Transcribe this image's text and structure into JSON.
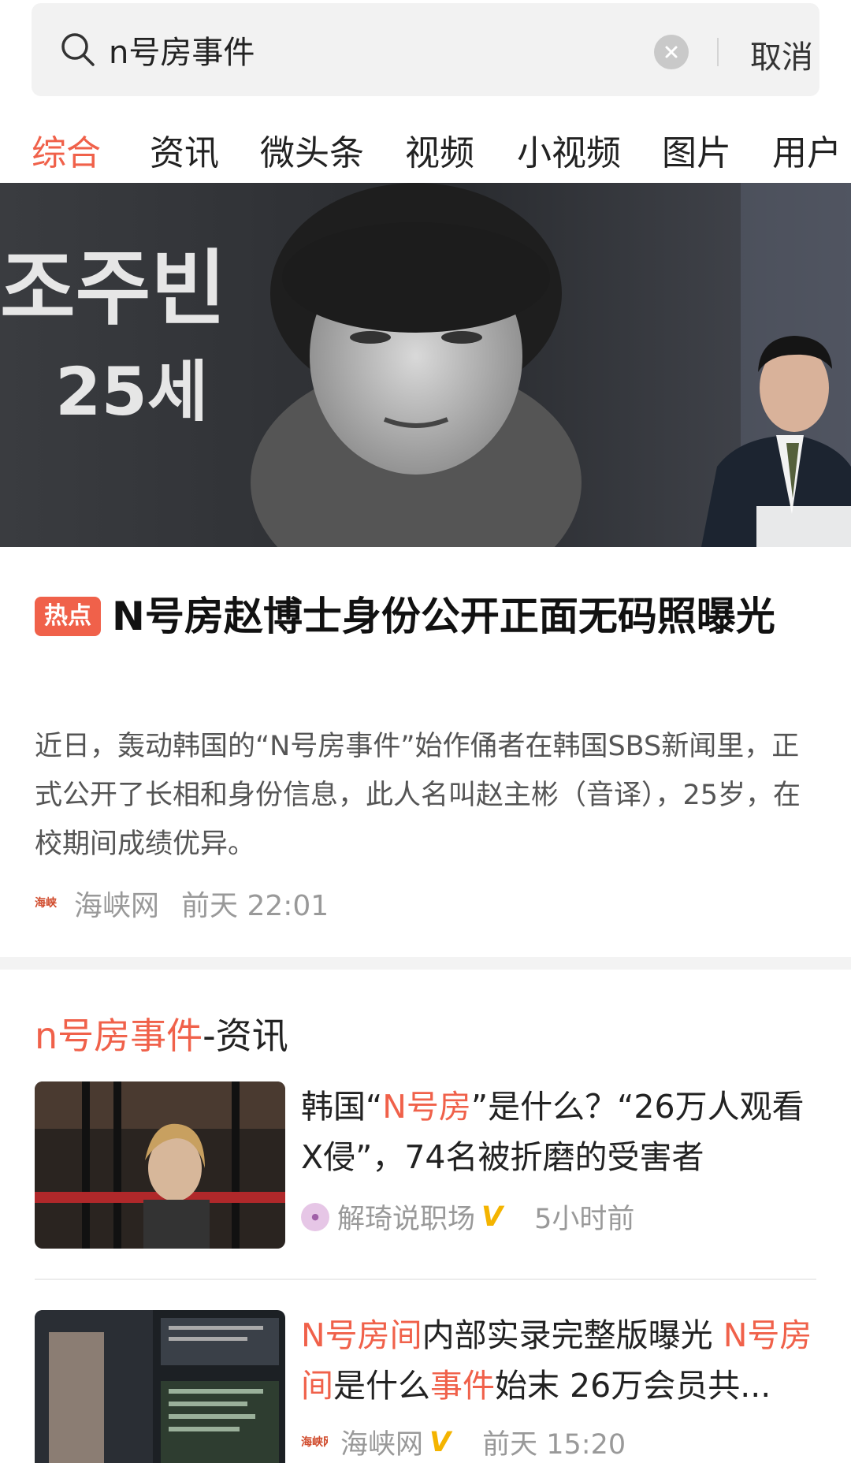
{
  "search": {
    "query": "n号房事件",
    "cancel_label": "取消"
  },
  "tabs": [
    {
      "label": "综合",
      "active": true
    },
    {
      "label": "资讯"
    },
    {
      "label": "微头条"
    },
    {
      "label": "视频"
    },
    {
      "label": "小视频"
    },
    {
      "label": "图片"
    },
    {
      "label": "用户"
    }
  ],
  "hero": {
    "overlay_name": "조주빈",
    "overlay_age": "25세"
  },
  "featured": {
    "badge": "热点",
    "title": "N号房赵博士身份公开正面无码照曝光",
    "summary": "近日，轰动韩国的“N号房事件”始作俑者在韩国SBS新闻里，正式公开了长相和身份信息，此人名叫赵主彬（音译），25岁，在校期间成绩优异。",
    "source": "海峡网",
    "time": "前天 22:01"
  },
  "section": {
    "highlight": "n号房事件",
    "suffix": "-资讯"
  },
  "news": [
    {
      "title_parts": [
        "韩国“",
        "N号房",
        "”是什么？“26万人观看X侵”，74名被折磨的受害者"
      ],
      "source": "解琦说职场",
      "verified": "V",
      "time": "5小时前"
    },
    {
      "title_parts": [
        "N号房间",
        "内部实录完整版曝光 ",
        "N号房间",
        "是什么",
        "事件",
        "始末 26万会员共..."
      ],
      "source": "海峡网",
      "verified": "V",
      "time": "前天 15:20"
    }
  ],
  "colors": {
    "accent": "#f0614a",
    "verified": "#f4b400"
  }
}
